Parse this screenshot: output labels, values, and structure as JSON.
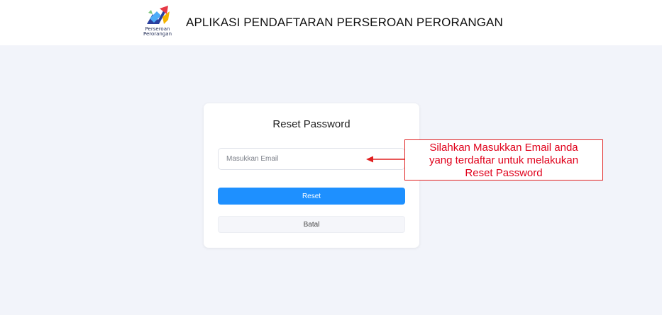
{
  "header": {
    "logo_line1": "Perseroan",
    "logo_line2": "Perorangan",
    "app_title": "APLIKASI PENDAFTARAN PERSEROAN PERORANGAN"
  },
  "card": {
    "title": "Reset Password",
    "email_placeholder": "Masukkan Email",
    "email_value": "",
    "reset_label": "Reset",
    "cancel_label": "Batal"
  },
  "annotation": {
    "lines": [
      "Silahkan Masukkan Email anda",
      "yang terdaftar untuk melakukan",
      "Reset Password"
    ],
    "color": "#e0001a"
  },
  "colors": {
    "primary": "#1e90ff",
    "background": "#f2f4fa"
  }
}
